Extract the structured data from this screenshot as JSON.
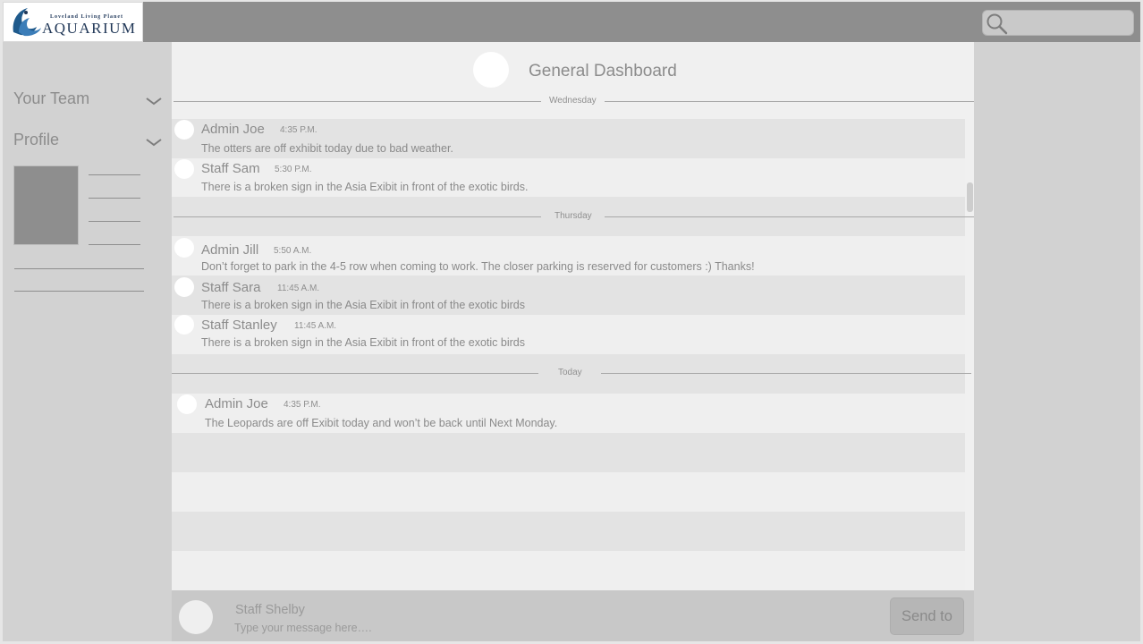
{
  "brand": {
    "logo_small": "Loveland Living Planet",
    "logo_big": "AQUARIUM"
  },
  "search": {
    "placeholder": ""
  },
  "sidebar": {
    "items": [
      {
        "label": "Your Team"
      },
      {
        "label": "Profile"
      }
    ]
  },
  "dashboard": {
    "title": "General Dashboard"
  },
  "days": [
    {
      "label": "Wednesday",
      "messages": [
        {
          "name": "Admin Joe",
          "time": "4:35 P.M.",
          "text": "The otters are off exhibit today due to bad weather."
        },
        {
          "name": "Staff Sam",
          "time": "5:30 P.M.",
          "text": "There is a broken sign in the Asia Exibit in front of the exotic birds."
        }
      ]
    },
    {
      "label": "Thursday",
      "messages": [
        {
          "name": "Admin Jill",
          "time": "5:50 A.M.",
          "text": "Don’t forget to park in the 4-5 row when coming to work. The closer parking is reserved for customers :) Thanks!"
        },
        {
          "name": "Staff Sara",
          "time": "11:45 A.M.",
          "text": "There is a broken sign in the Asia Exibit in front of the exotic birds"
        },
        {
          "name": "Staff Stanley",
          "time": "11:45 A.M.",
          "text": "There is a broken sign in the Asia Exibit in front of the exotic birds"
        }
      ]
    },
    {
      "label": "Today",
      "messages": [
        {
          "name": "Admin Joe",
          "time": "4:35 P.M.",
          "text": "The Leopards are off Exibit today and won’t be back until Next Monday."
        }
      ]
    }
  ],
  "composer": {
    "name": "Staff Shelby",
    "placeholder": "Type your message here….",
    "send_label": "Send to"
  },
  "colors": {
    "header": "#8e8e8e",
    "panel": "#d2d2d2",
    "logo_navy": "#1f3656"
  }
}
